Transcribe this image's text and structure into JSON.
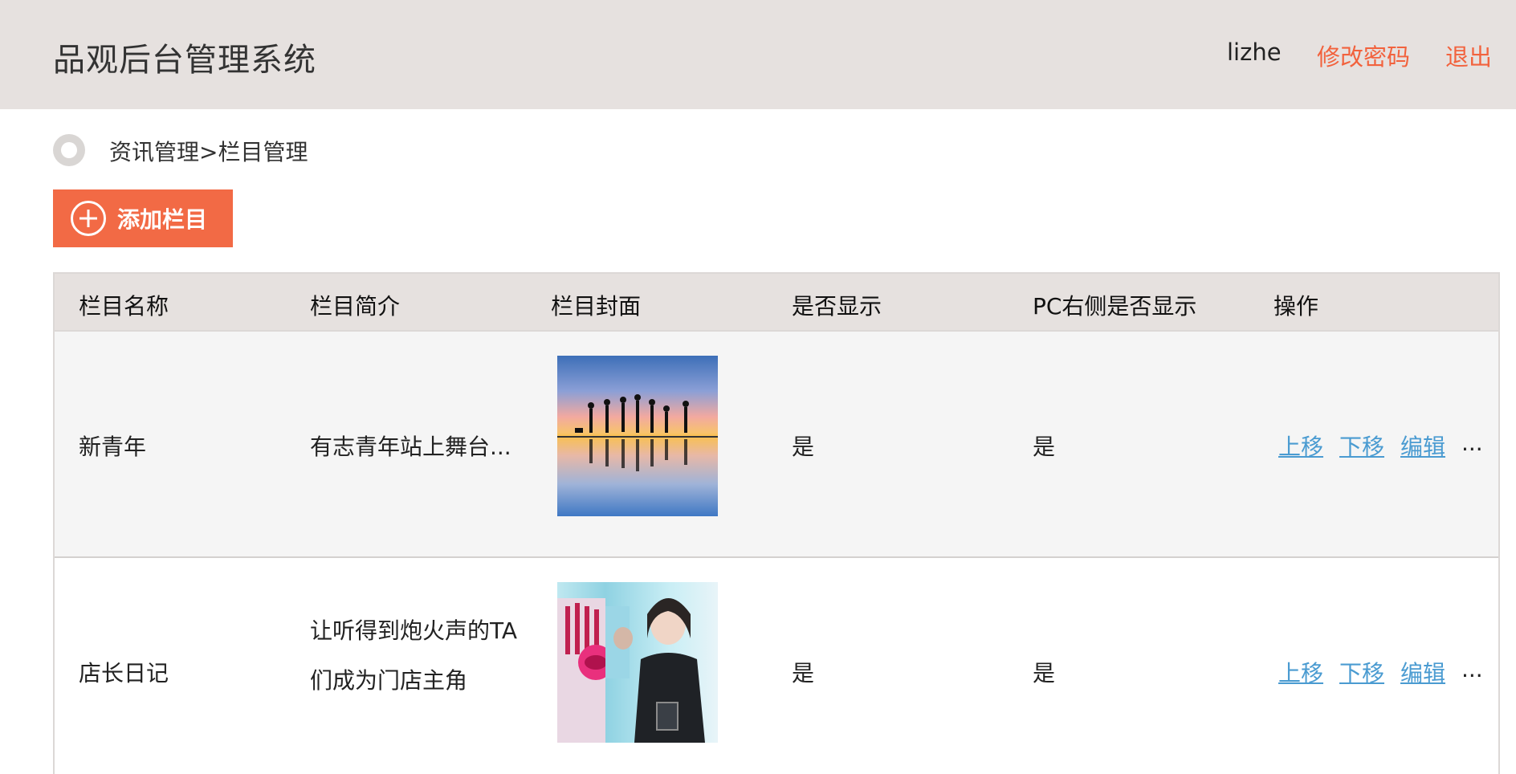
{
  "header": {
    "app_title": "品观后台管理系统",
    "user": "lizhe",
    "change_password": "修改密码",
    "logout": "退出"
  },
  "breadcrumb": {
    "text": "资讯管理>栏目管理"
  },
  "toolbar": {
    "add_label": "添加栏目"
  },
  "table": {
    "columns": [
      "栏目名称",
      "栏目简介",
      "栏目封面",
      "是否显示",
      "PC右侧是否显示",
      "操作"
    ],
    "rows": [
      {
        "name": "新青年",
        "intro": "有志青年站上舞台...",
        "cover_icon": "silhouette-jumping-sunset-image",
        "show": "是",
        "pc_right_show": "是",
        "actions": [
          "上移",
          "下移",
          "编辑",
          "..."
        ]
      },
      {
        "name": "店长日记",
        "intro_line1": "让听得到炮火声的TA",
        "intro_line2": "们成为门店主角",
        "cover_icon": "store-manager-portrait-image",
        "show": "是",
        "pc_right_show": "是",
        "actions": [
          "上移",
          "下移",
          "编辑",
          "..."
        ]
      }
    ]
  },
  "colors": {
    "header_bg": "#e6e1df",
    "accent_orange": "#f26a45",
    "link_blue": "#4a9bd1",
    "row_alt_bg": "#f5f5f5"
  }
}
